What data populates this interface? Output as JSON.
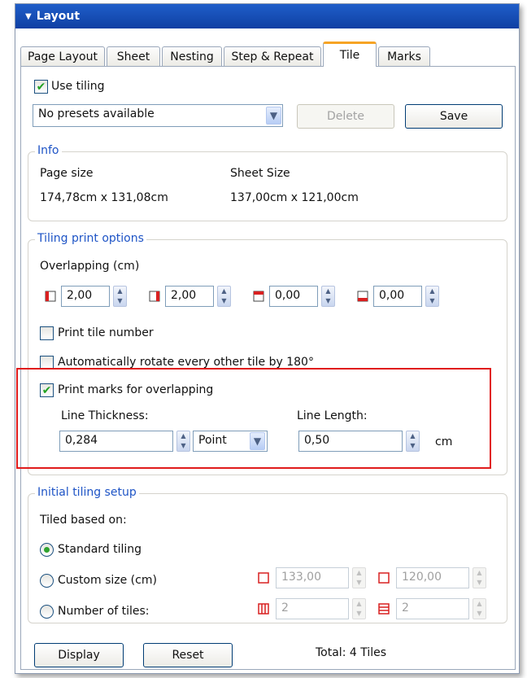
{
  "title": "Layout",
  "tabs": [
    "Page Layout",
    "Sheet",
    "Nesting",
    "Step & Repeat",
    "Tile",
    "Marks"
  ],
  "active_tab": "Tile",
  "use_tiling": {
    "label": "Use tiling",
    "checked": true
  },
  "preset": {
    "value": "No presets available"
  },
  "buttons": {
    "delete": "Delete",
    "save": "Save",
    "display": "Display",
    "reset": "Reset"
  },
  "info": {
    "legend": "Info",
    "page_size_label": "Page size",
    "page_size_value": "174,78cm x 131,08cm",
    "sheet_size_label": "Sheet Size",
    "sheet_size_value": "137,00cm x 121,00cm"
  },
  "tiling_print": {
    "legend": "Tiling print options",
    "overlapping_label": "Overlapping (cm)",
    "overlaps": [
      "2,00",
      "2,00",
      "0,00",
      "0,00"
    ],
    "print_tile_number": {
      "label": "Print tile number",
      "checked": false
    },
    "auto_rotate": {
      "label": "Automatically rotate every other tile by 180°",
      "checked": false
    },
    "print_marks": {
      "label": "Print marks for overlapping",
      "checked": true
    },
    "line_thickness_label": "Line Thickness:",
    "line_thickness_value": "0,284",
    "unit_value": "Point",
    "line_length_label": "Line Length:",
    "line_length_value": "0,50",
    "line_length_unit": "cm"
  },
  "initial_setup": {
    "legend": "Initial tiling setup",
    "based_on_label": "Tiled based on:",
    "standard": {
      "label": "Standard tiling",
      "selected": true
    },
    "custom": {
      "label": "Custom size (cm)",
      "selected": false,
      "width": "133,00",
      "height": "120,00"
    },
    "number": {
      "label": "Number of tiles:",
      "selected": false,
      "cols": "2",
      "rows": "2"
    }
  },
  "total": "Total: 4 Tiles",
  "colors": {
    "accent_tab": "#f6a425",
    "legend_text": "#1e54c6",
    "highlight": "#e01b1b",
    "titlebar": "#0f3fa3"
  }
}
